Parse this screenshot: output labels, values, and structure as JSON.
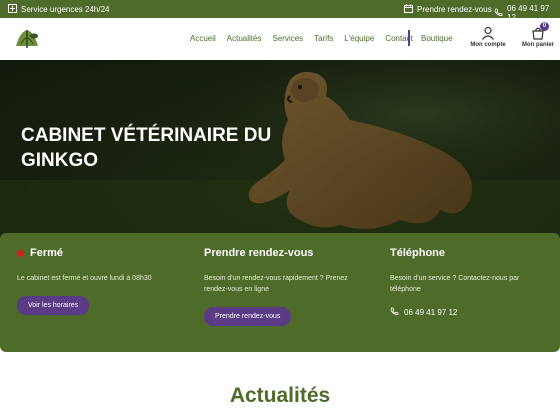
{
  "topbar": {
    "urgences": "Service urgences 24h/24",
    "rdv": "Prendre rendez-vous",
    "phone": "06 49 41 97 12"
  },
  "nav": {
    "items": [
      "Accueil",
      "Actualités",
      "Services",
      "Tarifs",
      "L'équipe",
      "Contact"
    ],
    "boutique": "Boutique",
    "account": "Mon compte",
    "cart": "Mon panier",
    "cart_count": "0"
  },
  "hero": {
    "title": "CABINET VÉTÉRINAIRE DU GINKGO"
  },
  "info": {
    "status": {
      "title": "Fermé",
      "text": "Le cabinet est fermé et ouvre lundi à 08h30",
      "button": "Voir les horaires"
    },
    "appointment": {
      "title": "Prendre rendez-vous",
      "text": "Besoin d'un rendez-vous rapidement ? Prenez rendez-vous en ligne",
      "button": "Prendre rendez-vous"
    },
    "phone": {
      "title": "Téléphone",
      "text": "Besoin d'un service ? Contactez-nous par téléphone",
      "number": "06 49 41 97 12"
    }
  },
  "news": {
    "title": "Actualités"
  },
  "colors": {
    "green": "#4e6b2a",
    "purple": "#5b3a86",
    "closed_dot": "#d61f1f"
  }
}
